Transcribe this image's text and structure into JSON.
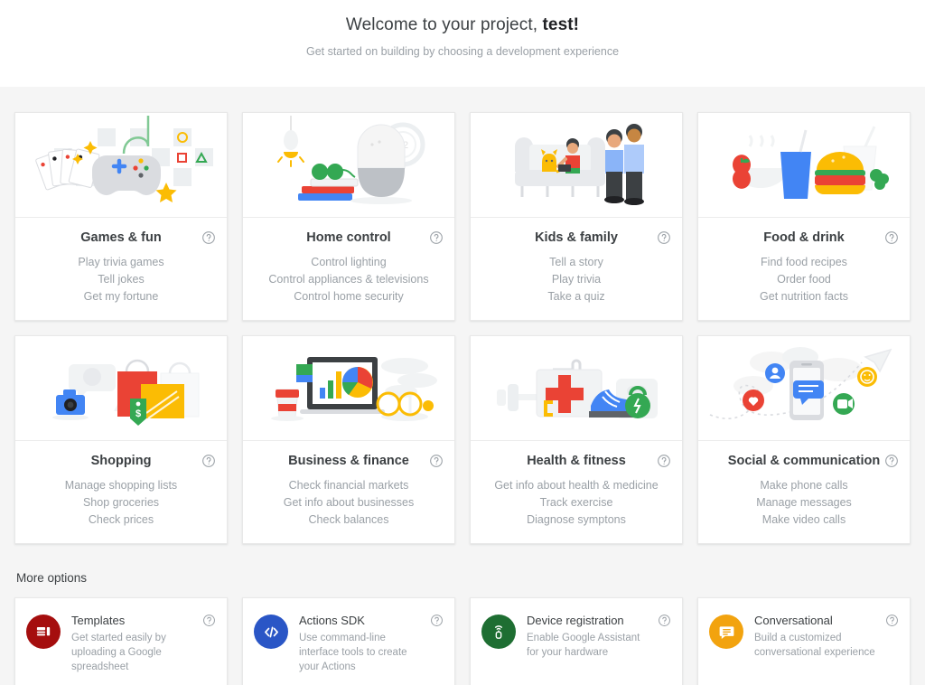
{
  "header": {
    "title_prefix": "Welcome to your project,",
    "project_name": "test!",
    "subtitle": "Get started on building by choosing a development experience"
  },
  "help_icon_name": "help-circle-icon",
  "categories": [
    {
      "title": "Games & fun",
      "illustration": "game-controller-illustration",
      "desc1": "Play trivia games",
      "desc2": "Tell jokes",
      "desc3": "Get my fortune"
    },
    {
      "title": "Home control",
      "illustration": "smart-speaker-illustration",
      "desc1": "Control lighting",
      "desc2": "Control appliances & televisions",
      "desc3": "Control home security"
    },
    {
      "title": "Kids & family",
      "illustration": "family-couch-illustration",
      "desc1": "Tell a story",
      "desc2": "Play trivia",
      "desc3": "Take a quiz"
    },
    {
      "title": "Food & drink",
      "illustration": "burger-drink-illustration",
      "desc1": "Find food recipes",
      "desc2": "Order food",
      "desc3": "Get nutrition facts"
    },
    {
      "title": "Shopping",
      "illustration": "shopping-bags-illustration",
      "desc1": "Manage shopping lists",
      "desc2": "Shop groceries",
      "desc3": "Check prices"
    },
    {
      "title": "Business & finance",
      "illustration": "laptop-charts-illustration",
      "desc1": "Check financial markets",
      "desc2": "Get info about businesses",
      "desc3": "Check balances"
    },
    {
      "title": "Health & fitness",
      "illustration": "first-aid-sneaker-illustration",
      "desc1": "Get info about health & medicine",
      "desc2": "Track exercise",
      "desc3": "Diagnose symptons"
    },
    {
      "title": "Social & communication",
      "illustration": "phone-social-illustration",
      "desc1": "Make phone calls",
      "desc2": "Manage messages",
      "desc3": "Make video calls"
    }
  ],
  "more_options": {
    "label": "More options",
    "items": [
      {
        "title": "Templates",
        "desc": "Get started easily by uploading a Google spreadsheet",
        "icon_name": "spreadsheet-template-icon",
        "icon_color": "#A50E0E"
      },
      {
        "title": "Actions SDK",
        "desc": "Use command-line interface tools to create your Actions",
        "icon_name": "code-brackets-icon",
        "icon_color": "#2A56C6"
      },
      {
        "title": "Device registration",
        "desc": "Enable Google Assistant for your hardware",
        "icon_name": "smart-device-icon",
        "icon_color": "#1E6E32"
      },
      {
        "title": "Conversational",
        "desc": "Build a customized conversational experience",
        "icon_name": "chat-bubble-icon",
        "icon_color": "#F2A30F"
      }
    ]
  },
  "colors": {
    "page_background": "#FFFFFF",
    "content_background": "#F5F5F5",
    "card_background": "#FFFFFF",
    "title_text": "#3C4043",
    "muted_text": "#9AA0A6",
    "google_blue": "#4285F4",
    "google_red": "#EA4335",
    "google_yellow": "#FBBC04",
    "google_green": "#34A853"
  }
}
